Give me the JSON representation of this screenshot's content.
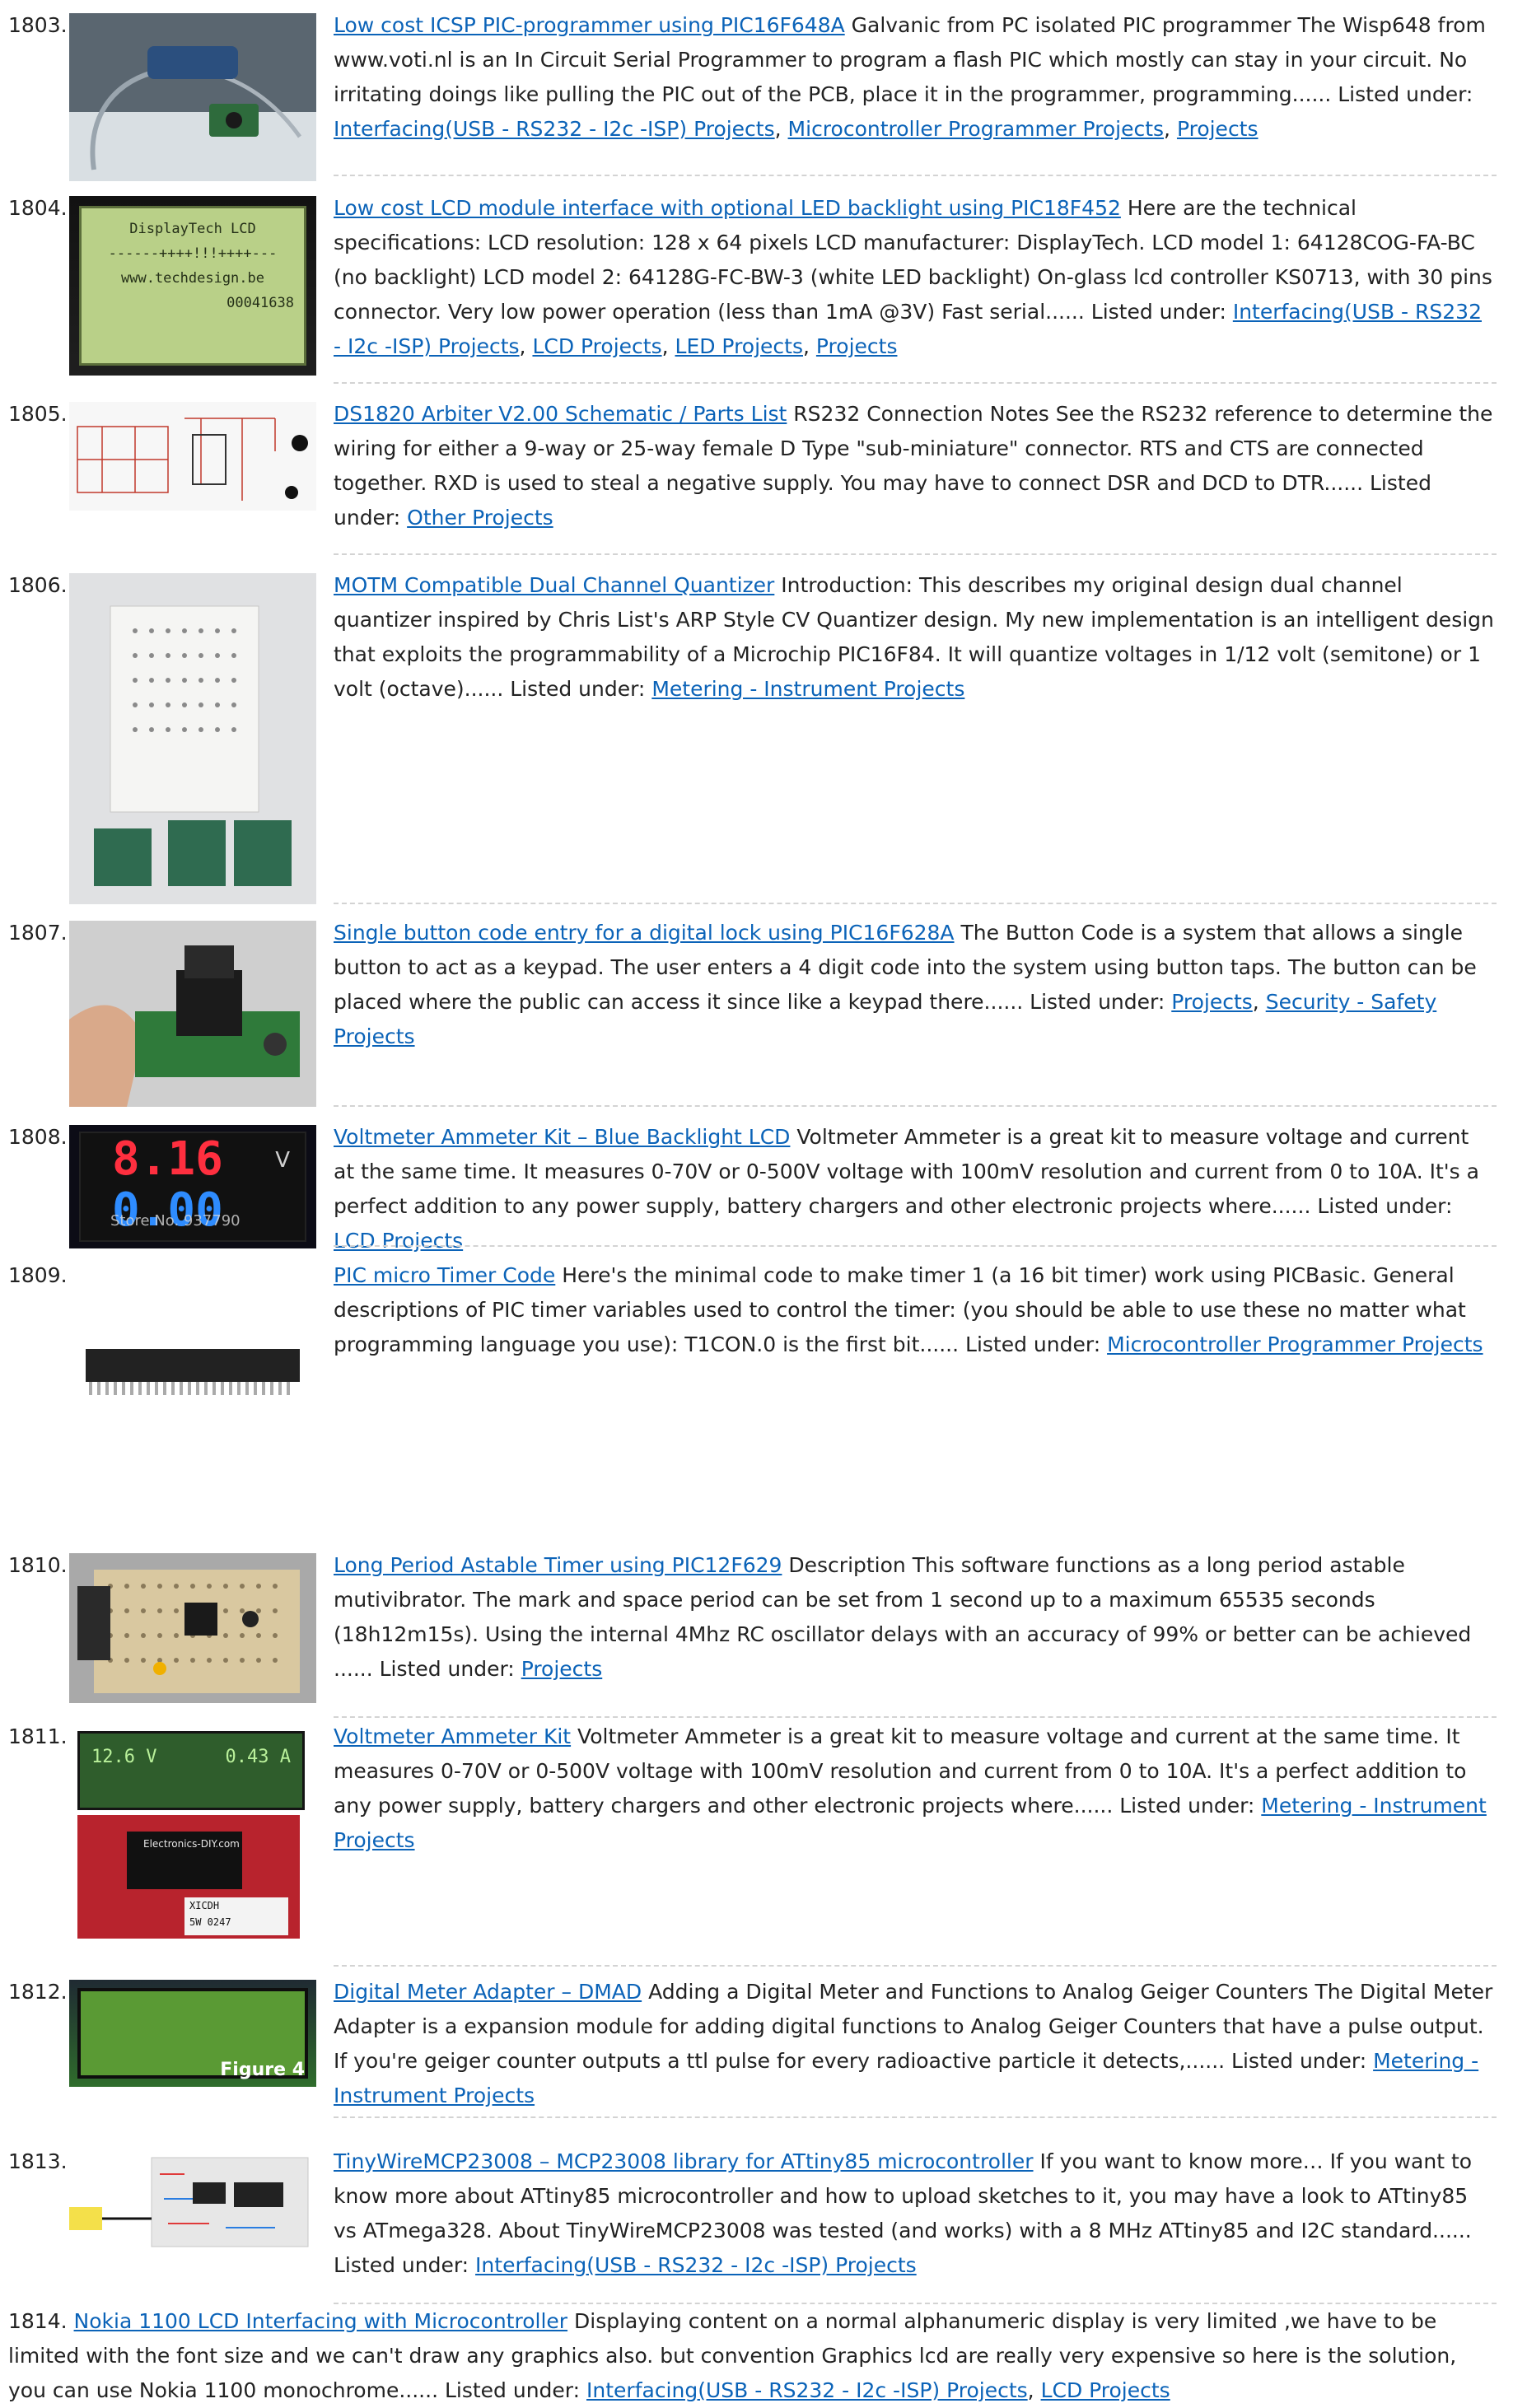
{
  "entries": [
    {
      "number": "1803.",
      "title": "Low cost ICSP PIC-programmer using PIC16F648A",
      "description": " Galvanic from PC isolated PIC programmer The Wisp648 from www.voti.nl is an In Circuit Serial Programmer to program a flash PIC which mostly can stay in your circuit. No irritating doings like pulling the PIC out of the PCB, place it in the programmer, programming...... Listed under: ",
      "categories": [
        "Interfacing(USB - RS232 - I2c -ISP) Projects",
        "Microcontroller Programmer Projects",
        "Projects"
      ]
    },
    {
      "number": "1804.",
      "title": "Low cost LCD module interface with optional LED backlight using PIC18F452",
      "description": " Here are the technical specifications: LCD resolution: 128 x 64 pixels LCD manufacturer: DisplayTech. LCD model 1: 64128COG-FA-BC (no backlight) LCD model 2: 64128G-FC-BW-3 (white LED backlight) On-glass lcd controller KS0713, with 30 pins connector. Very low power operation (less than 1mA @3V) Fast serial...... Listed under: ",
      "categories": [
        "Interfacing(USB - RS232 - I2c -ISP) Projects",
        "LCD Projects",
        "LED Projects",
        "Projects"
      ],
      "thumb_lines": [
        "DisplayTech LCD",
        "------++++!!!++++---",
        "www.techdesign.be",
        "00041638"
      ]
    },
    {
      "number": "1805.",
      "title": "DS1820 Arbiter V2.00 Schematic / Parts List",
      "description": " RS232 Connection Notes See the RS232 reference to determine the wiring for either a 9-way or 25-way female D Type \"sub-miniature\" connector. RTS and CTS are connected together. RXD is used to steal a negative supply. You may have to connect DSR and DCD to DTR...... Listed under: ",
      "categories": [
        "Other Projects"
      ]
    },
    {
      "number": "1806.",
      "title": "MOTM Compatible Dual Channel Quantizer",
      "description": " Introduction: This describes my original design dual channel quantizer inspired by Chris List's ARP Style CV Quantizer design. My new implementation is an intelligent design that exploits the programmability of a Microchip PIC16F84. It will quantize voltages in 1/12 volt (semitone) or 1 volt (octave)...... Listed under: ",
      "categories": [
        "Metering - Instrument Projects"
      ]
    },
    {
      "number": "1807.",
      "title": "Single button code entry for a digital lock using PIC16F628A",
      "description": " The Button Code is a system that allows a single button to act as a keypad. The user enters a 4 digit code into the system using button taps. The button can be placed where the public can access it since like a keypad there...... Listed under: ",
      "categories": [
        "Projects",
        "Security - Safety Projects"
      ]
    },
    {
      "number": "1808.",
      "title": "Voltmeter Ammeter Kit – Blue Backlight LCD",
      "description": " Voltmeter Ammeter is a great kit to measure voltage and current at the same time. It measures 0-70V or 0-500V voltage with 100mV resolution and current from 0 to 10A. It's a perfect addition to any power supply, battery chargers and other electronic projects where...... Listed under: ",
      "categories": [
        "LCD Projects"
      ],
      "thumb_lines": [
        "8.16",
        "V",
        "0.00",
        "Store No. 937790"
      ]
    },
    {
      "number": "1809.",
      "title": "PIC micro Timer Code",
      "description": " Here's the minimal code to make timer 1 (a 16 bit timer) work using PICBasic. General descriptions of PIC timer variables used to control the timer: (you should be able to use these no matter what programming language you use): T1CON.0 is the first bit...... Listed under: ",
      "categories": [
        "Microcontroller Programmer Projects"
      ]
    },
    {
      "number": "1810.",
      "title": "Long Period Astable Timer using PIC12F629",
      "description": " Description This software functions as a long period astable mutivibrator.  The mark and space period can be set from 1 second up to a maximum 65535 seconds (18h12m15s). Using the internal 4Mhz RC oscillator delays with an accuracy of 99% or better can be achieved ...... Listed under: ",
      "categories": [
        "Projects"
      ]
    },
    {
      "number": "1811.",
      "title": "Voltmeter Ammeter Kit",
      "description": " Voltmeter Ammeter is a great kit to measure voltage and current at the same time. It measures 0-70V or 0-500V voltage with 100mV resolution and current from 0 to 10A. It's a perfect addition to any power supply, battery chargers and other electronic projects where...... Listed under: ",
      "categories": [
        "Metering - Instrument Projects"
      ],
      "thumb_lines": [
        "12.6 V",
        "0.43 A",
        "Electronics-DIY.com",
        "XICDH",
        "5W 0247"
      ]
    },
    {
      "number": "1812.",
      "title": "Digital Meter Adapter – DMAD",
      "description": " Adding a Digital Meter and Functions to Analog Geiger Counters The Digital Meter Adapter is a expansion module for adding digital functions to Analog Geiger Counters that have a pulse output. If you're geiger counter outputs a ttl pulse for every radioactive particle it detects,...... Listed under: ",
      "categories": [
        "Metering - Instrument Projects"
      ],
      "thumb_lines": [
        "Figure 4"
      ]
    },
    {
      "number": "1813.",
      "title": "TinyWireMCP23008 – MCP23008 library for ATtiny85 microcontroller",
      "description": " If you want to know more… If you want to know more about ATtiny85 microcontroller and how to upload sketches to it, you may have a look to ATtiny85 vs ATmega328. About TinyWireMCP23008 was tested (and works) with a 8 MHz ATtiny85 and I2C standard...... Listed under: ",
      "categories": [
        "Interfacing(USB - RS232 - I2c -ISP) Projects"
      ]
    },
    {
      "number": "1814.",
      "title": "Nokia 1100 LCD Interfacing with Microcontroller",
      "description": "  Displaying content on a normal alphanumeric display is very limited ,we have to be limited with the font size and we can't draw any graphics also. but convention Graphics lcd are really very expensive so here is the solution, you can use Nokia 1100 monochrome...... Listed under: ",
      "categories": [
        "Interfacing(USB - RS232 - I2c -ISP) Projects",
        "LCD Projects"
      ]
    }
  ]
}
